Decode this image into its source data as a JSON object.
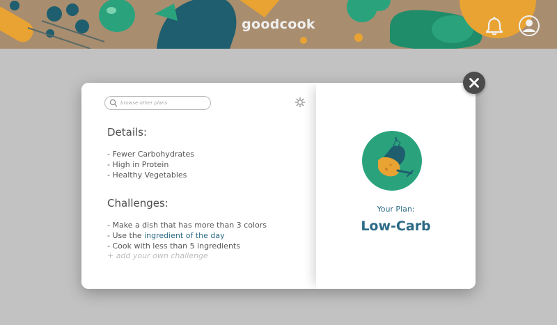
{
  "header": {
    "brand": "goodcook",
    "bell_icon": "bell-icon",
    "profile_icon": "user-avatar-icon",
    "colors": {
      "background": "#a98d6f",
      "teal": "#1e5e6e",
      "orange": "#e8a333",
      "green": "#2aa37d",
      "brand_text": "#efefef"
    }
  },
  "modal": {
    "search": {
      "placeholder": "browse other plans",
      "value": ""
    },
    "settings_icon": "gear-icon",
    "close_icon": "close-icon",
    "details": {
      "title": "Details:",
      "items": [
        "- Fewer Carbohydrates",
        "- High in Protein",
        "- Healthy Vegetables"
      ]
    },
    "challenges": {
      "title": "Challenges:",
      "item1": "- Make a dish that has more than 3 colors",
      "item2_prefix": "- Use the ",
      "item2_link": "ingredient of the day",
      "item3": "- Cook with less than 5 ingredients",
      "add_label": "+ add your own challenge"
    },
    "plan": {
      "label": "Your Plan:",
      "name": "Low-Carb",
      "badge_icon": "eggplant-and-chicken-icon"
    }
  },
  "colors": {
    "overlay": "#c2c2c2",
    "accent": "#2b6a85",
    "badge": "#2aa37d",
    "close_button": "#4b4b4b"
  }
}
